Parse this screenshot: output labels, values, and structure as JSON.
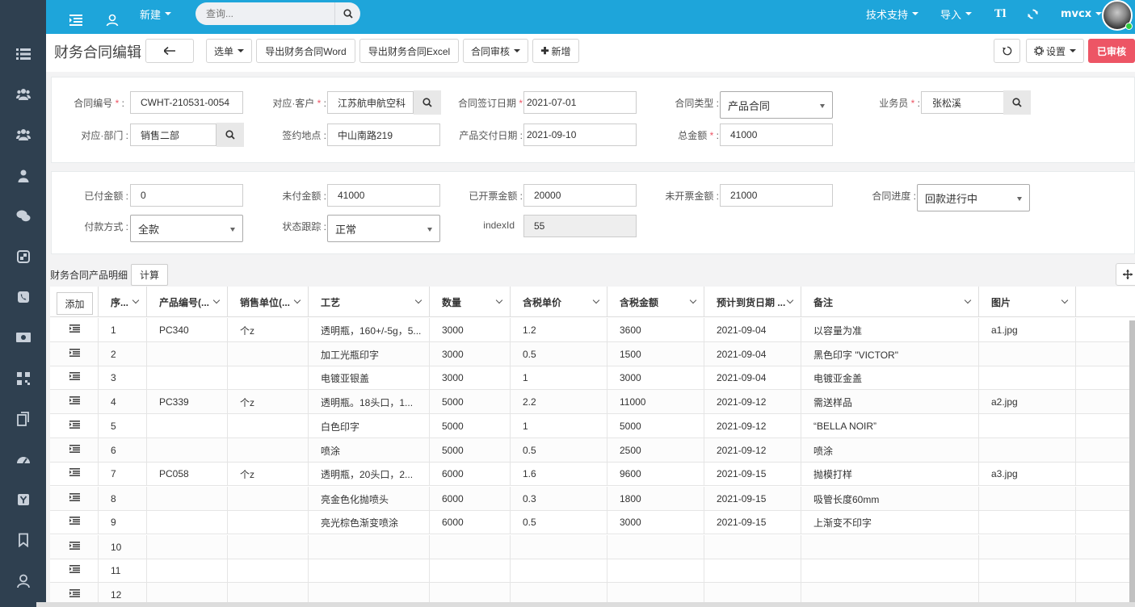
{
  "topbar": {
    "new_label": "新建",
    "search_placeholder": "查询...",
    "tech_support": "技术支持",
    "import": "导入",
    "ti": "Tl",
    "user": "mvcx"
  },
  "toolbar": {
    "title": "财务合同编辑",
    "menu": "选单",
    "export_word": "导出财务合同Word",
    "export_excel": "导出财务合同Excel",
    "audit": "合同审核",
    "new": "新增",
    "settings": "设置",
    "audited": "已审核"
  },
  "form": {
    "contract_no_label": "合同编号",
    "contract_no": "CWHT-210531-0054",
    "customer_label": "对应·客户",
    "customer": "江苏航申航空科",
    "sign_date_label": "合同签订日期",
    "sign_date": "2021-07-01",
    "type_label": "合同类型",
    "type": "产品合同",
    "salesman_label": "业务员",
    "salesman": "张松溪",
    "dept_label": "对应·部门",
    "dept": "销售二部",
    "sign_place_label": "签约地点",
    "sign_place": "中山南路219",
    "delivery_date_label": "产品交付日期",
    "delivery_date": "2021-09-10",
    "total_label": "总金额",
    "total": "41000"
  },
  "payment": {
    "paid_label": "已付金额",
    "paid": "0",
    "unpaid_label": "未付金额",
    "unpaid": "41000",
    "invoiced_label": "已开票金额",
    "invoiced": "20000",
    "uninvoiced_label": "未开票金额",
    "uninvoiced": "21000",
    "progress_label": "合同进度",
    "progress": "回款进行中",
    "method_label": "付款方式",
    "method": "全款",
    "status_label": "状态跟踪",
    "status": "正常",
    "index_label": "indexId",
    "index": "55"
  },
  "grid": {
    "title": "财务合同产品明细",
    "calc": "计算",
    "add": "添加",
    "columns": [
      "序...",
      "产品编号(...",
      "销售单位(...",
      "工艺",
      "数量",
      "含税单价",
      "含税金额",
      "预计到货日期 ...",
      "备注",
      "图片"
    ],
    "rows": [
      [
        "1",
        "PC340",
        "个z",
        "透明瓶，160+/-5g，5...",
        "3000",
        "1.2",
        "3600",
        "2021-09-04",
        "以容量为准",
        "a1.jpg"
      ],
      [
        "2",
        "",
        "",
        "加工光瓶印字",
        "3000",
        "0.5",
        "1500",
        "2021-09-04",
        "黑色印字 \"VICTOR\"",
        ""
      ],
      [
        "3",
        "",
        "",
        "电镀亚银盖",
        "3000",
        "1",
        "3000",
        "2021-09-04",
        "电镀亚金盖",
        ""
      ],
      [
        "4",
        "PC339",
        "个z",
        "透明瓶。18头口，1...",
        "5000",
        "2.2",
        "11000",
        "2021-09-12",
        "需送样品",
        "a2.jpg"
      ],
      [
        "5",
        "",
        "",
        "白色印字",
        "5000",
        "1",
        "5000",
        "2021-09-12",
        "“BELLA NOIR”",
        ""
      ],
      [
        "6",
        "",
        "",
        "喷涂",
        "5000",
        "0.5",
        "2500",
        "2021-09-12",
        "喷涂",
        ""
      ],
      [
        "7",
        "PC058",
        "个z",
        "透明瓶，20头口，2...",
        "6000",
        "1.6",
        "9600",
        "2021-09-15",
        "抛模打样",
        "a3.jpg"
      ],
      [
        "8",
        "",
        "",
        "亮金色化抛喷头",
        "6000",
        "0.3",
        "1800",
        "2021-09-15",
        "吸管长度60mm",
        ""
      ],
      [
        "9",
        "",
        "",
        "亮光棕色渐变喷涂",
        "6000",
        "0.5",
        "3000",
        "2021-09-15",
        "上渐变不印字",
        ""
      ],
      [
        "10",
        "",
        "",
        "",
        "",
        "",
        "",
        "",
        "",
        ""
      ],
      [
        "11",
        "",
        "",
        "",
        "",
        "",
        "",
        "",
        "",
        ""
      ],
      [
        "12",
        "",
        "",
        "",
        "",
        "",
        "",
        "",
        "",
        ""
      ]
    ]
  }
}
